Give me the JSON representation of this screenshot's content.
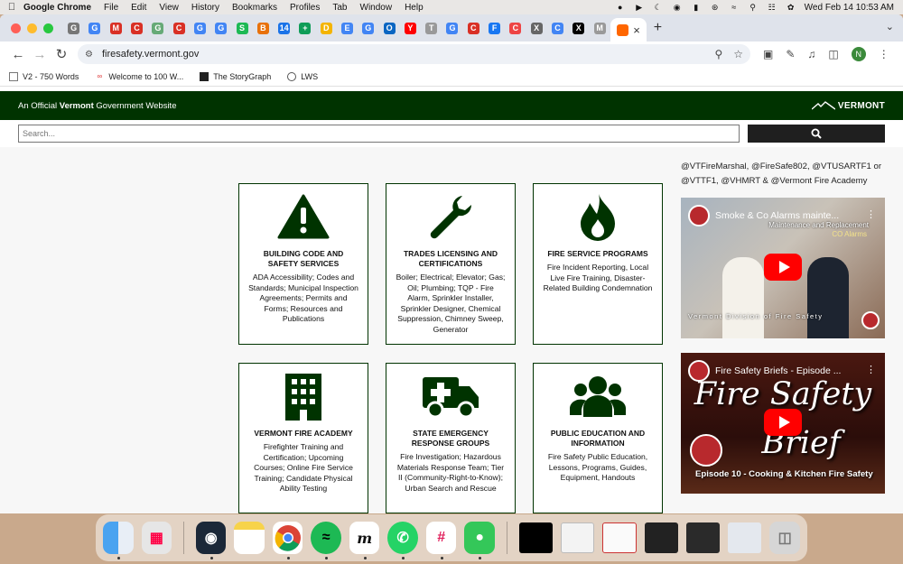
{
  "menubar": {
    "app_name": "Google Chrome",
    "items": [
      "File",
      "Edit",
      "View",
      "History",
      "Bookmarks",
      "Profiles",
      "Tab",
      "Window",
      "Help"
    ],
    "clock": "Wed Feb 14  10:53 AM"
  },
  "browser": {
    "url": "firesafety.vermont.gov",
    "profile_initial": "N",
    "tab_favicons": [
      "G",
      "G",
      "M",
      "C",
      "G",
      "C",
      "G",
      "G",
      "S",
      "B",
      "14",
      "+",
      "D",
      "E",
      "G",
      "O",
      "Y",
      "T",
      "G",
      "C",
      "F",
      "C",
      "X",
      "C",
      "X",
      "M"
    ],
    "bookmarks": [
      {
        "label": "V2 - 750 Words",
        "icon": "doc-icon"
      },
      {
        "label": "Welcome to 100 W...",
        "icon": "hundred-icon"
      },
      {
        "label": "The StoryGraph",
        "icon": "books-icon"
      },
      {
        "label": "LWS",
        "icon": "globe-icon"
      }
    ]
  },
  "site": {
    "official_text_pre": "An Official ",
    "official_text_bold": "Vermont",
    "official_text_post": " Government Website",
    "logo_text": "VERMONT",
    "search_placeholder": "Search...",
    "social_text": "@VTFireMarshal, @FireSafe802, @VTUSARTF1 or @VTTF1, @VHMRT & @Vermont Fire Academy",
    "cards": [
      {
        "title": "Building Code and Safety Services",
        "desc": "ADA Accessibility; Codes and Standards; Municipal Inspection Agreements; Permits and Forms; Resources and Publications",
        "icon": "warning-icon"
      },
      {
        "title": "Trades Licensing and Certifications",
        "desc": "Boiler; Electrical; Elevator; Gas; Oil; Plumbing; TQP - Fire Alarm, Sprinkler Installer, Sprinkler Designer, Chemical Suppression, Chimney Sweep, Generator",
        "icon": "wrench-icon"
      },
      {
        "title": "Fire Service Programs",
        "desc": "Fire Incident Reporting, Local Live Fire Training, Disaster-Related Building Condemnation",
        "icon": "flame-icon"
      },
      {
        "title": "Vermont Fire Academy",
        "desc": "Firefighter Training and Certification; Upcoming Courses; Online Fire Service Training; Candidate Physical Ability Testing",
        "icon": "building-icon"
      },
      {
        "title": "State Emergency Response Groups",
        "desc": "Fire Investigation; Hazardous Materials Response Team; Tier II (Community-Right-to-Know); Urban Search and Rescue",
        "icon": "ambulance-icon"
      },
      {
        "title": "Public Education and Information",
        "desc": "Fire Safety Public Education, Lessons, Programs, Guides, Equipment, Handouts",
        "icon": "people-icon"
      }
    ],
    "videos": [
      {
        "title": "Smoke & Co Alarms mainte...",
        "subtitle": "Maintenance and Replacement",
        "subtitle2": "CO Alarms",
        "footer": "Vermont Division of Fire Safety"
      },
      {
        "title": "Fire Safety Briefs - Episode ...",
        "big_line1": "Fire Safety",
        "big_line2": "Brief",
        "episode": "Episode 10  - Cooking & Kitchen Fire Safety"
      }
    ]
  },
  "colors": {
    "vermont_green": "#003300",
    "accent_red": "#ff0000"
  }
}
